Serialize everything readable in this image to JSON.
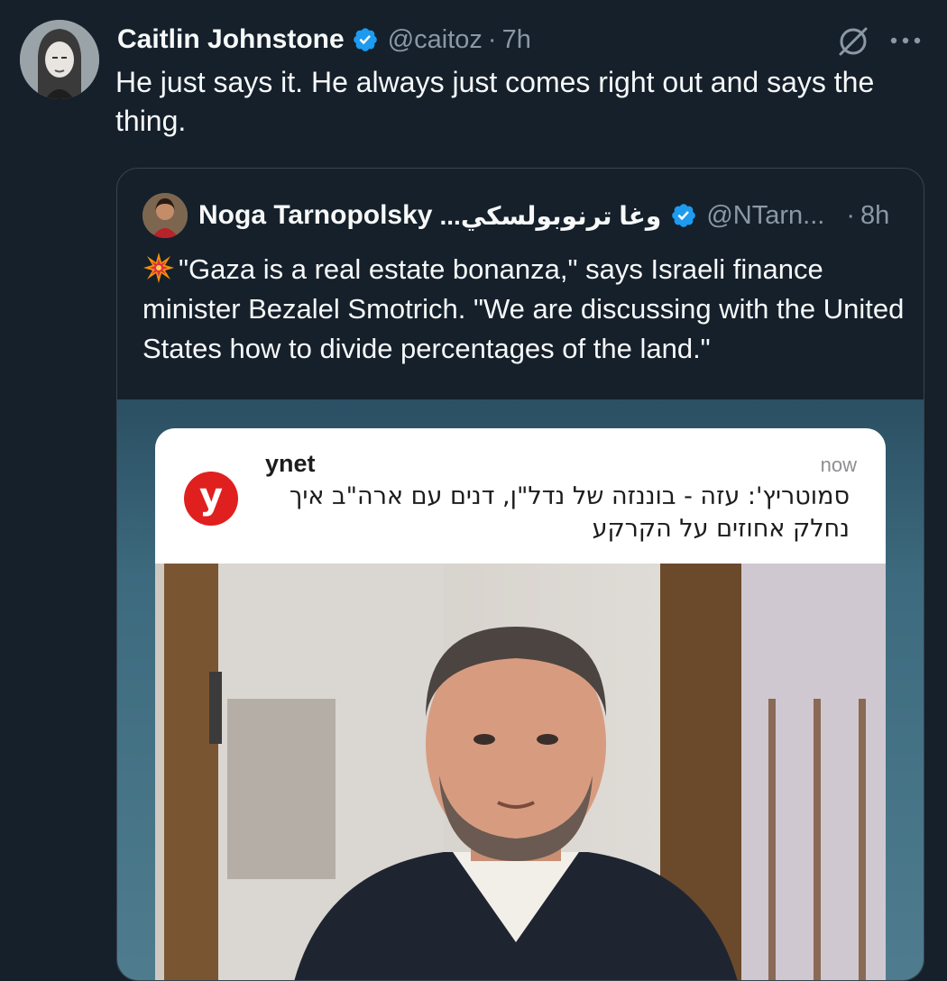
{
  "tweet": {
    "display_name": "Caitlin Johnstone",
    "handle": "@caitoz",
    "separator": "·",
    "time": "7h",
    "text": "He just says it. He always just comes right out and says the thing."
  },
  "quote": {
    "display_name": "Noga Tarnopolsky",
    "display_name_ar": "...وغا ترنوبولسكي",
    "handle": "@NTarn...",
    "separator": "·",
    "time": "8h",
    "text": "\"Gaza is a real estate bonanza,\" says Israeli finance minister Bezalel Smotrich. \"We are discussing with the United States how to divide percentages of the land.\""
  },
  "media": {
    "notification": {
      "app_name": "ynet",
      "time": "now",
      "logo_letter": "y",
      "body": "סמוטריץ': עזה - בוננזה של נדל\"ן, דנים עם ארה\"ב איך נחלק אחוזים על הקרקע"
    }
  },
  "colors": {
    "background": "#15202b",
    "verified_blue": "#1d9bf0",
    "secondary_text": "#8b98a5",
    "ynet_red": "#e0201e"
  }
}
